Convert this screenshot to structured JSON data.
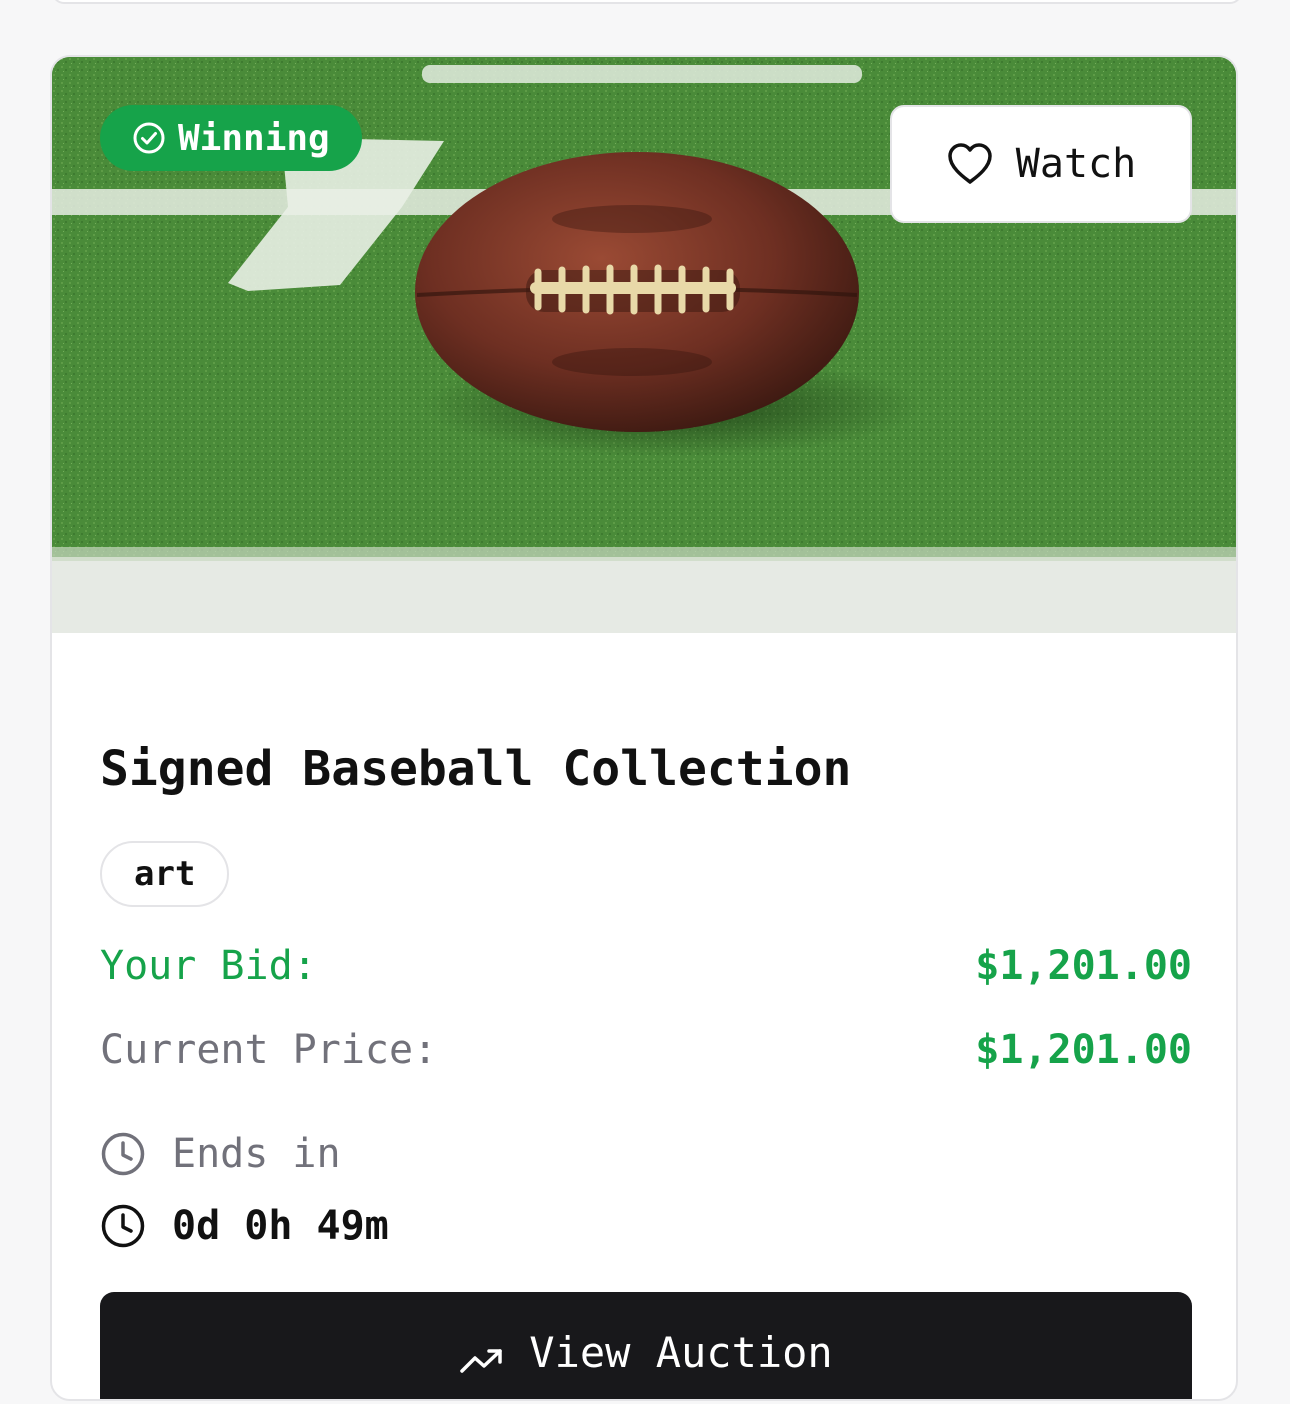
{
  "card": {
    "status_badge": "Winning",
    "watch_label": "Watch",
    "title": "Signed Baseball Collection",
    "tag": "art",
    "your_bid_label": "Your Bid:",
    "your_bid_value": "$1,201.00",
    "current_price_label": "Current Price:",
    "current_price_value": "$1,201.00",
    "ends_label": "Ends in",
    "countdown": "0d 0h 49m",
    "view_button_label": "View Auction"
  },
  "icons": {
    "badge": "check-circle-icon",
    "watch": "heart-icon",
    "ends": "clock-icon",
    "countdown": "clock-icon",
    "view": "trending-up-icon"
  },
  "colors": {
    "accent_green": "#16a34a",
    "button_dark": "#18181b",
    "muted_text": "#71717a",
    "border": "#e4e4e7"
  }
}
